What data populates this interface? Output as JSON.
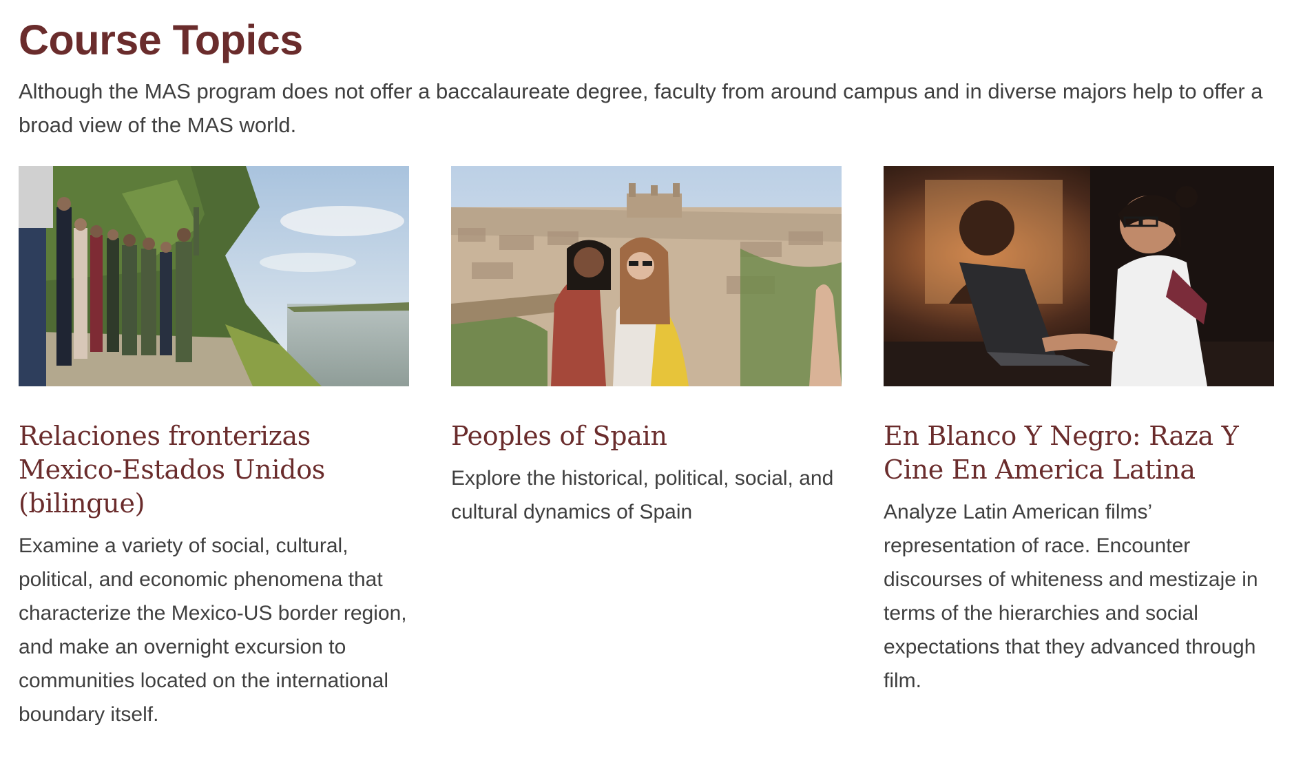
{
  "section": {
    "title": "Course Topics",
    "intro": "Although the MAS program does not offer a baccalaureate degree, faculty from around campus and in diverse majors help to offer a broad view of the MAS world."
  },
  "cards": [
    {
      "title": "Relaciones fronterizas Mexico-Estados Unidos (bilingue)",
      "description": "Examine a variety of social, cultural, political, and economic phenomena that characterize the Mexico-US border region, and make an overnight excursion to communities located on the international boundary itself.",
      "image_icon": "riverbank-group-photo"
    },
    {
      "title": "Peoples of Spain",
      "description": "Explore the historical, political, social, and cultural dynamics of Spain",
      "image_icon": "city-overlook-photo"
    },
    {
      "title": "En Blanco Y Negro: Raza Y Cine En America Latina",
      "description": "Analyze Latin American films’ representation of race. Encounter discourses of whiteness and mestizaje in terms of the hierarchies and social expectations that they advanced through film.",
      "image_icon": "laptop-screening-photo"
    }
  ],
  "colors": {
    "heading": "#6a2c2c",
    "body_text": "#3f3f3f",
    "background": "#ffffff"
  }
}
